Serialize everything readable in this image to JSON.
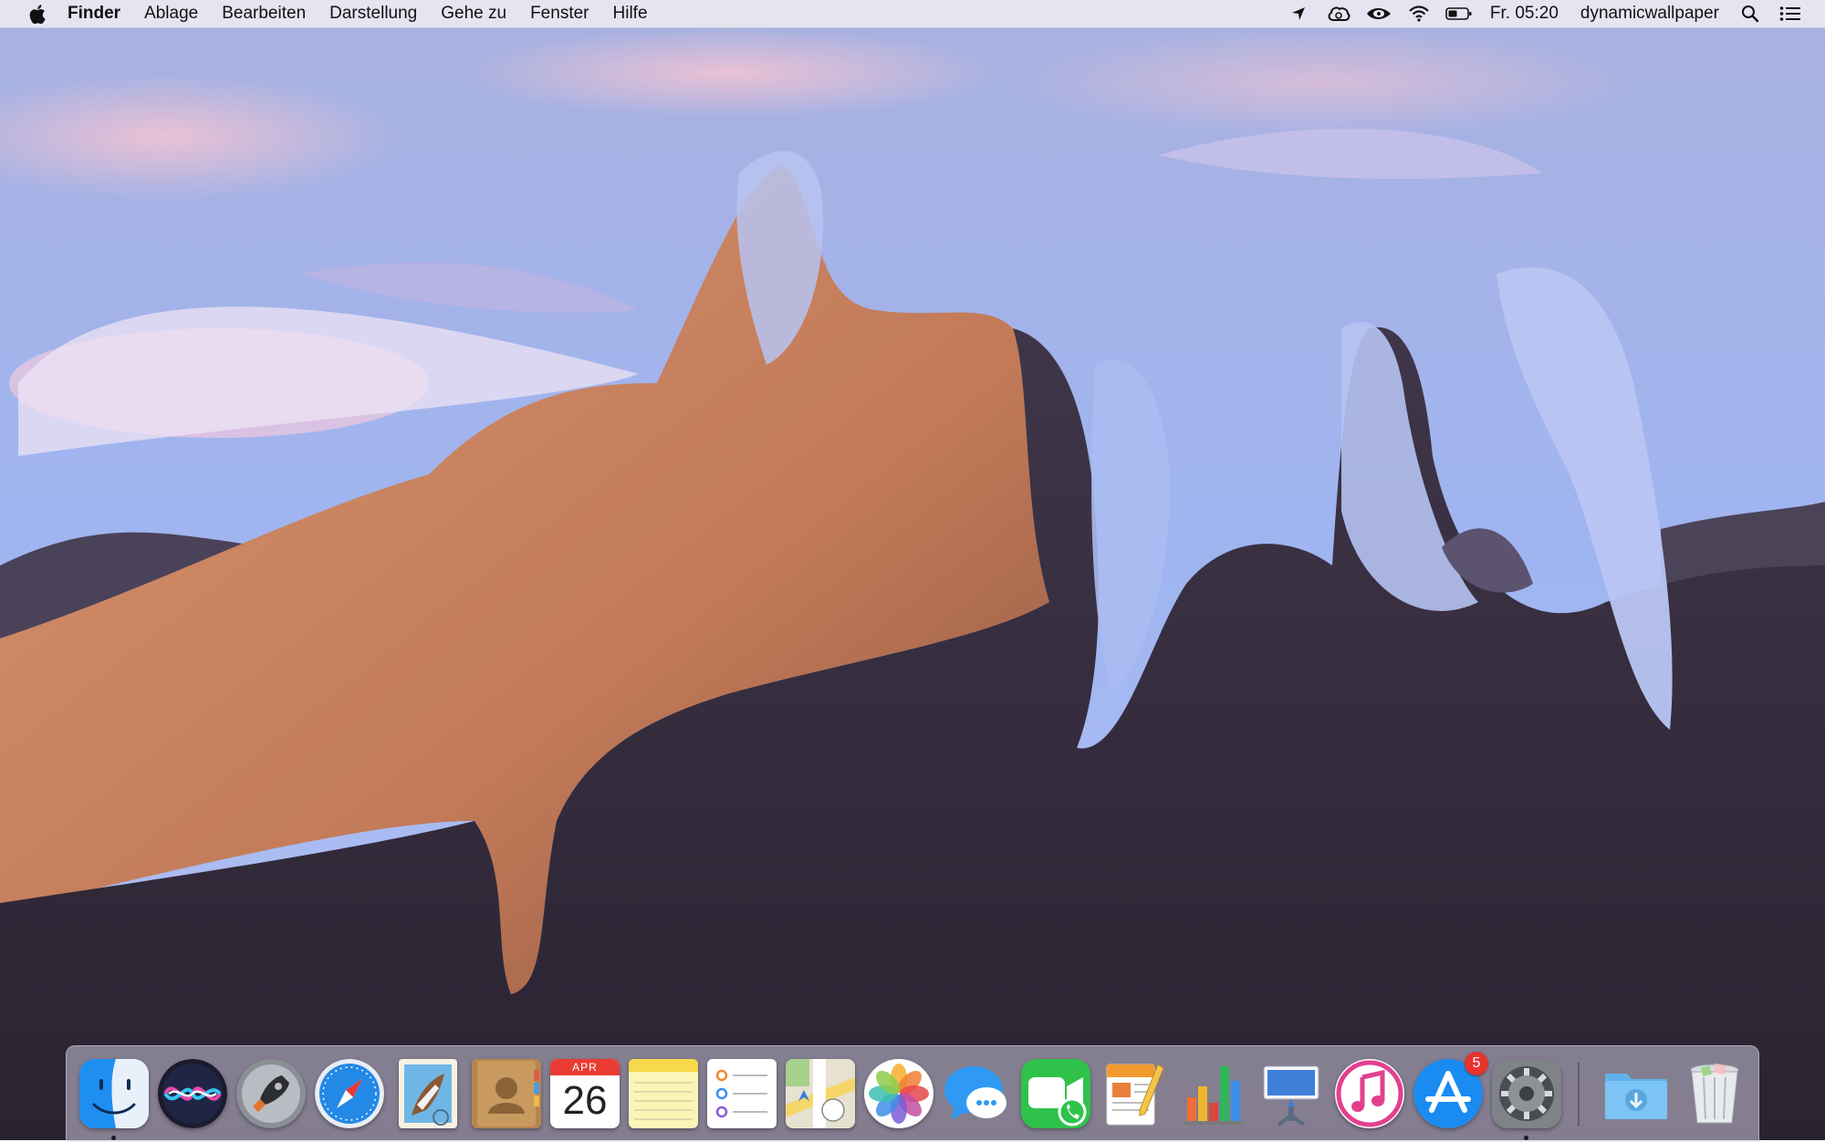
{
  "menubar": {
    "app_name": "Finder",
    "menus": [
      "Ablage",
      "Bearbeiten",
      "Darstellung",
      "Gehe zu",
      "Fenster",
      "Hilfe"
    ],
    "status_icons": [
      "location-arrow-icon",
      "creative-cloud-icon",
      "nvidia-icon",
      "wifi-icon",
      "battery-icon"
    ],
    "clock": "Fr. 05:20",
    "app_status_label": "dynamicwallpaper"
  },
  "calendar": {
    "month": "APR",
    "day": "26"
  },
  "dock": {
    "apps": [
      {
        "name": "Finder",
        "icon": "finder-icon",
        "running": true
      },
      {
        "name": "Siri",
        "icon": "siri-icon",
        "running": false
      },
      {
        "name": "Launchpad",
        "icon": "launchpad-icon",
        "running": false
      },
      {
        "name": "Safari",
        "icon": "safari-icon",
        "running": false
      },
      {
        "name": "Mail",
        "icon": "mail-icon",
        "running": false
      },
      {
        "name": "Kontakte",
        "icon": "contacts-icon",
        "running": false
      },
      {
        "name": "Kalender",
        "icon": "calendar-icon",
        "running": false
      },
      {
        "name": "Notizen",
        "icon": "notes-icon",
        "running": false
      },
      {
        "name": "Erinnerungen",
        "icon": "reminders-icon",
        "running": false
      },
      {
        "name": "Karten",
        "icon": "maps-icon",
        "running": false
      },
      {
        "name": "Fotos",
        "icon": "photos-icon",
        "running": false
      },
      {
        "name": "Nachrichten",
        "icon": "messages-icon",
        "running": false
      },
      {
        "name": "FaceTime",
        "icon": "facetime-icon",
        "running": false
      },
      {
        "name": "Pages",
        "icon": "pages-icon",
        "running": false
      },
      {
        "name": "Numbers",
        "icon": "numbers-icon",
        "running": false
      },
      {
        "name": "Keynote",
        "icon": "keynote-icon",
        "running": false
      },
      {
        "name": "iTunes",
        "icon": "itunes-icon",
        "running": false
      },
      {
        "name": "App Store",
        "icon": "app-store-icon",
        "running": false,
        "badge": "5"
      },
      {
        "name": "Systemeinstellungen",
        "icon": "system-preferences-icon",
        "running": true
      }
    ],
    "stack": [
      {
        "name": "Downloads",
        "icon": "downloads-folder-icon"
      },
      {
        "name": "Papierkorb",
        "icon": "trash-icon"
      }
    ]
  },
  "colors": {
    "sky": "#a3b4ec",
    "cloud_pink": "#e7b9cf",
    "dune_orange": "#c9805d",
    "dune_dark": "#2f2838",
    "badge_red": "#e8322d"
  }
}
